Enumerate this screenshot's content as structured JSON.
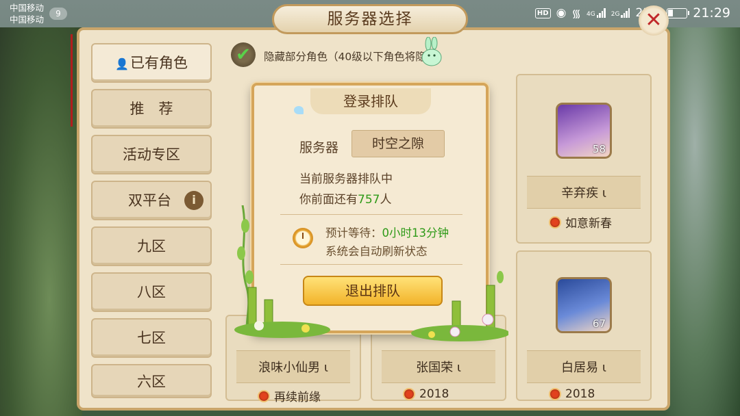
{
  "status_bar": {
    "carrier_1": "中国移动",
    "carrier_2": "中国移动",
    "notification_count": "9",
    "hd": "HD",
    "net_1": "4G",
    "net_2": "2G",
    "battery_percent": "23%",
    "battery_level": 0.23,
    "time": "21:29"
  },
  "header": {
    "title": "服务器选择",
    "close_symbol": "✕"
  },
  "sidebar": {
    "items": [
      {
        "label": "已有角色"
      },
      {
        "label": "推　荐"
      },
      {
        "label": "活动专区"
      },
      {
        "label": "双平台",
        "badge": "i"
      },
      {
        "label": "九区"
      },
      {
        "label": "八区"
      },
      {
        "label": "七区"
      },
      {
        "label": "六区"
      }
    ]
  },
  "filter": {
    "label": "隐藏部分角色（40级以下角色将隐藏）",
    "checked": true
  },
  "cards": [
    {
      "name": "辛弃疾",
      "level": "58",
      "server": "如意新春"
    },
    {
      "name": "浪味小仙男",
      "server": "再续前缘"
    },
    {
      "name": "张国荣",
      "server": "2018"
    },
    {
      "name": "白居易",
      "level": "67",
      "server": "2018"
    }
  ],
  "card_mark": "ι",
  "dialog": {
    "title": "登录排队",
    "server_label": "服务器",
    "server_value": "时空之隙",
    "queue_status": "当前服务器排队中",
    "ahead_prefix": "你前面还有",
    "ahead_count": "757",
    "ahead_suffix": "人",
    "wait_label": "预计等待：",
    "wait_value": "0小时13分钟",
    "auto_refresh": "系统会自动刷新状态",
    "exit_button": "退出排队"
  },
  "colors": {
    "accent_green": "#2e9a18",
    "gold": "#f2b32a",
    "status_red": "#e2421e"
  }
}
